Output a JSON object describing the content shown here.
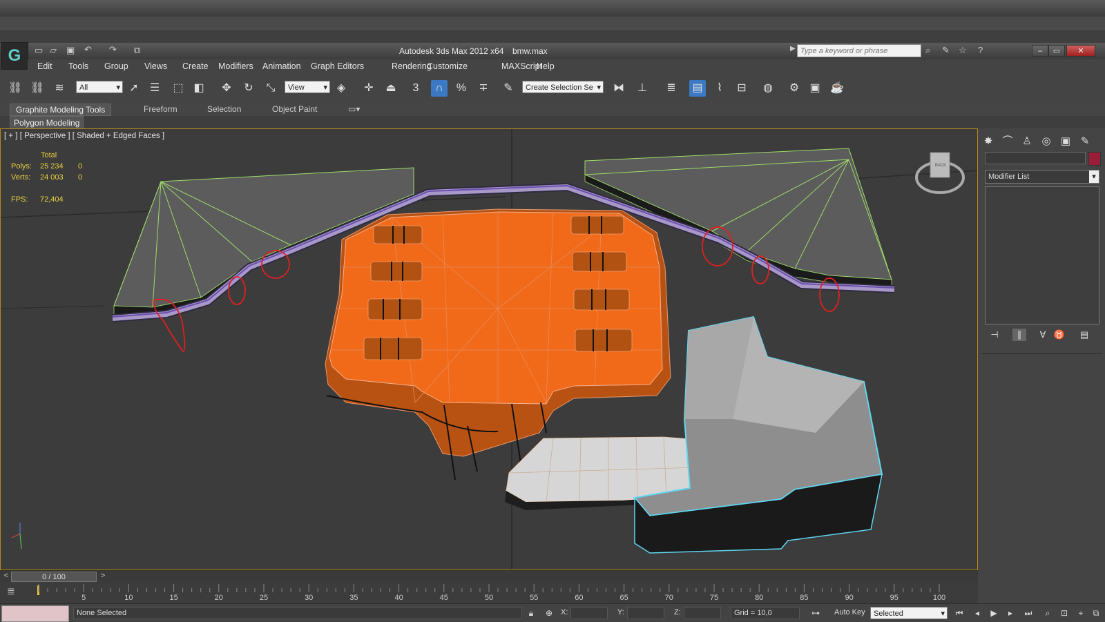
{
  "app": {
    "title": "Autodesk 3ds Max  2012 x64",
    "file": "bmw.max",
    "search_placeholder": "Type a keyword or phrase"
  },
  "menu": [
    "Edit",
    "Tools",
    "Group",
    "Views",
    "Create",
    "Modifiers",
    "Animation",
    "Graph Editors",
    "Rendering",
    "Customize",
    "MAXScript",
    "Help"
  ],
  "toolbar": {
    "selection_filter": "All",
    "ref_coord": "View",
    "named_selection": "Create Selection Se",
    "snap_label": "3",
    "angle_snap_label": "%"
  },
  "ribbon": {
    "tabs": [
      "Graphite Modeling Tools",
      "Freeform",
      "Selection",
      "Object Paint"
    ],
    "active_tab": "Graphite Modeling Tools",
    "panel": "Polygon Modeling"
  },
  "viewport": {
    "label": "[ + ] [ Perspective ] [ Shaded + Edged Faces ]",
    "stats": {
      "header": "Total",
      "polys_label": "Polys:",
      "polys_total": "25 234",
      "polys_sel": "0",
      "verts_label": "Verts:",
      "verts_total": "24 003",
      "verts_sel": "0",
      "fps_label": "FPS:",
      "fps_value": "72,404"
    },
    "viewcube_label": "BACK"
  },
  "command_panel": {
    "modifier_list": "Modifier List",
    "object_color": "#9a1e3a"
  },
  "time": {
    "frame_display": "0 / 100",
    "prev": "<",
    "next": ">",
    "ticks": [
      "5",
      "10",
      "15",
      "20",
      "25",
      "30",
      "35",
      "40",
      "45",
      "50",
      "55",
      "60",
      "65",
      "70",
      "75",
      "80",
      "85",
      "90",
      "95",
      "100"
    ]
  },
  "status": {
    "selection": "None Selected",
    "x_label": "X:",
    "y_label": "Y:",
    "z_label": "Z:",
    "grid": "Grid = 10,0",
    "auto_key": "Auto Key",
    "set_key_mode": "Selected"
  },
  "colors": {
    "accent": "#3c79c4",
    "viewport_border": "#b8891a",
    "stats_text": "#e8d040",
    "mesh_orange": "#f06a1a",
    "selection_cyan": "#5fd6f0",
    "edge_green": "#9fdc6a",
    "annotation_red": "#e02020"
  }
}
